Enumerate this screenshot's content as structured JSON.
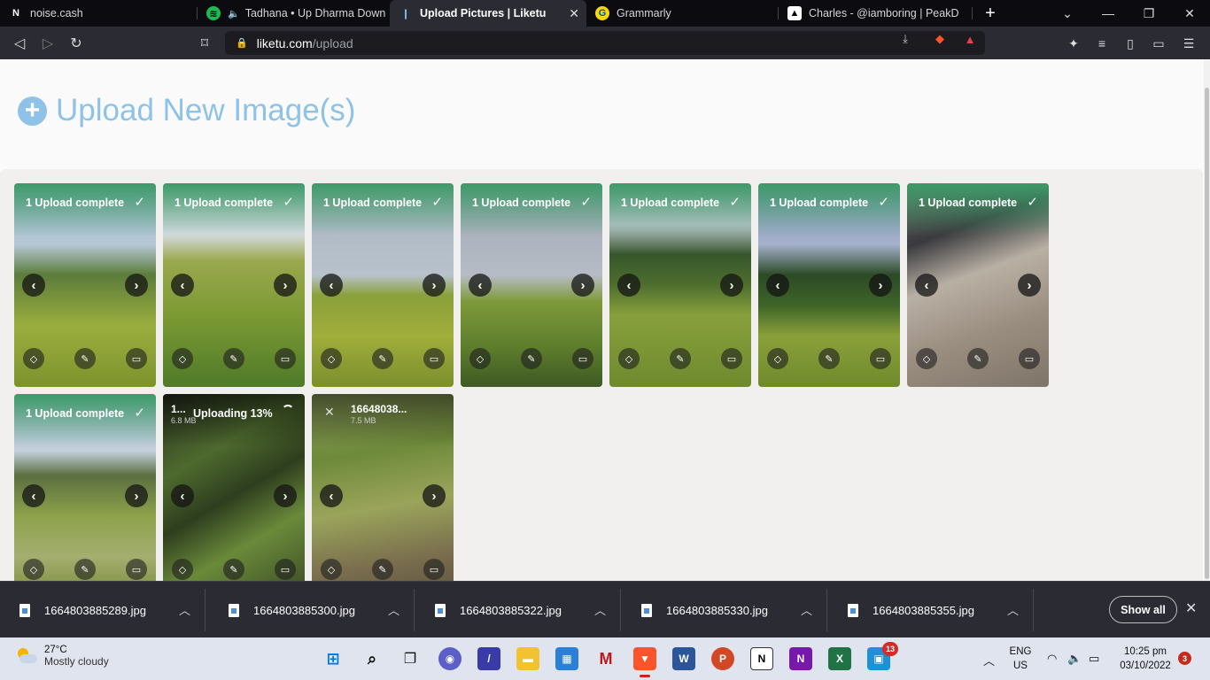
{
  "tabs": [
    {
      "title": "noise.cash",
      "icon": "noise-cash-icon"
    },
    {
      "title": "Tadhana • Up Dharma Down",
      "icon": "spotify-icon"
    },
    {
      "title": "Upload Pictures | Liketu",
      "icon": "liketu-icon",
      "active": true
    },
    {
      "title": "Grammarly",
      "icon": "grammarly-icon"
    },
    {
      "title": "Charles - @iamboring | PeakD",
      "icon": "peakd-icon"
    }
  ],
  "address": {
    "host": "liketu.com",
    "path": "/upload"
  },
  "page": {
    "title": "Upload New Image(s)"
  },
  "cards": [
    {
      "status": "1 Upload complete"
    },
    {
      "status": "1 Upload complete"
    },
    {
      "status": "1 Upload complete"
    },
    {
      "status": "1 Upload complete"
    },
    {
      "status": "1 Upload complete"
    },
    {
      "status": "1 Upload complete"
    },
    {
      "status": "1 Upload complete"
    },
    {
      "status": "1 Upload complete"
    },
    {
      "status": "Uploading 13%",
      "name": "1...",
      "size": "6.8 MB",
      "progress": 0.13
    },
    {
      "name": "16648038...",
      "size": "7.5 MB"
    }
  ],
  "downloads": [
    {
      "name": "1664803885289.jpg"
    },
    {
      "name": "1664803885300.jpg"
    },
    {
      "name": "1664803885322.jpg"
    },
    {
      "name": "1664803885330.jpg"
    },
    {
      "name": "1664803885355.jpg"
    }
  ],
  "shelf": {
    "show_all": "Show all"
  },
  "taskbar": {
    "weather_temp": "27°C",
    "weather_desc": "Mostly cloudy",
    "lang_1": "ENG",
    "lang_2": "US",
    "time": "10:25 pm",
    "date": "03/10/2022",
    "badge_count": "13",
    "notification_count": "3"
  }
}
